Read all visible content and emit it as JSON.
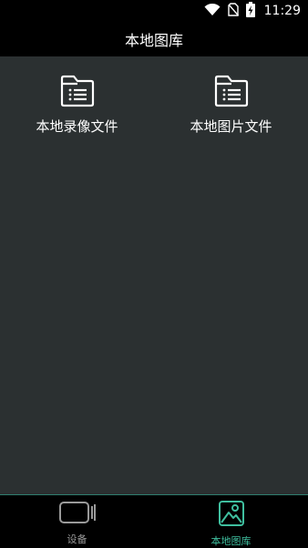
{
  "status_bar": {
    "time": "11:29",
    "icons": [
      "wifi-icon",
      "no-sim-icon",
      "battery-charging-icon"
    ]
  },
  "app_bar": {
    "title": "本地图库"
  },
  "tiles": [
    {
      "label": "本地录像文件",
      "icon": "folder-list-icon"
    },
    {
      "label": "本地图片文件",
      "icon": "folder-list-icon"
    }
  ],
  "bottom_nav": {
    "items": [
      {
        "label": "设备",
        "icon": "video-camera-icon",
        "active": false
      },
      {
        "label": "本地图库",
        "icon": "gallery-icon",
        "active": true
      }
    ]
  },
  "colors": {
    "background": "#000000",
    "content_bg": "#2b3031",
    "accent": "#3fbf9f",
    "inactive": "#9a9a9a"
  }
}
